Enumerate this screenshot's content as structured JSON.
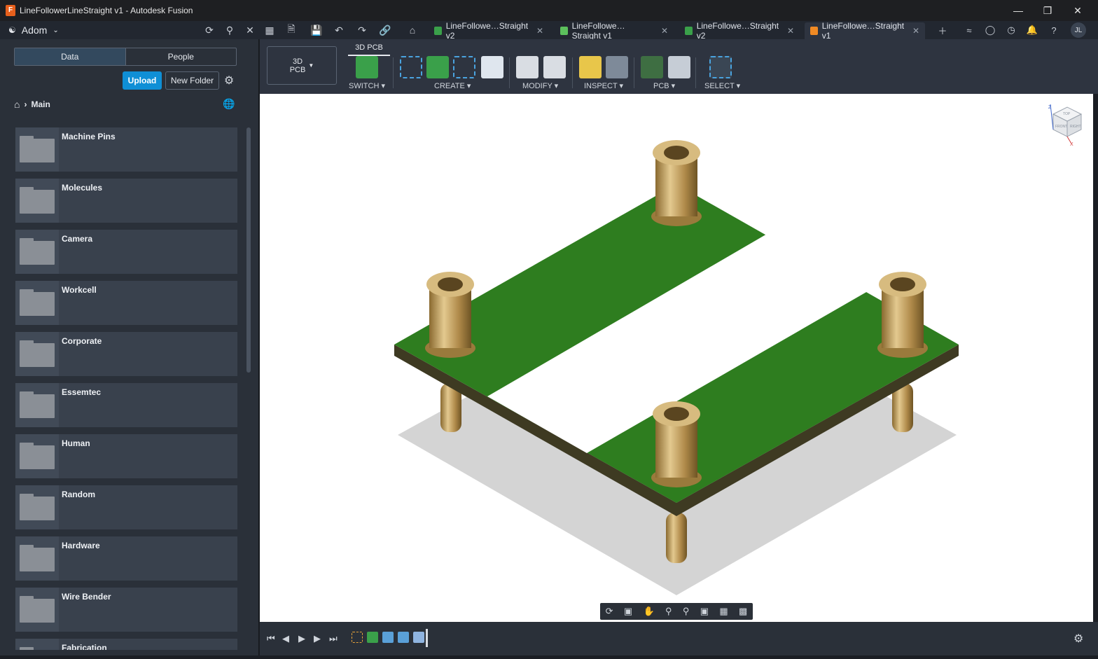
{
  "window": {
    "title": "LineFollowerLineStraight v1 - Autodesk Fusion",
    "app_icon": "F"
  },
  "appbar": {
    "user": "Adom",
    "tabs": [
      {
        "label": "LineFollowe…Straight v2",
        "icon": "pcb-icon",
        "active": false
      },
      {
        "label": "LineFollowe…Straight v1",
        "icon": "schematic-icon",
        "active": false
      },
      {
        "label": "LineFollowe…Straight v2",
        "icon": "pcb-icon",
        "active": false
      },
      {
        "label": "LineFollowe…Straight v1",
        "icon": "3d-pcb-icon",
        "active": true
      }
    ],
    "avatar": "JL"
  },
  "datapanel": {
    "tab_data": "Data",
    "tab_people": "People",
    "upload": "Upload",
    "new_folder": "New Folder",
    "breadcrumb": "Main",
    "folders": [
      "Machine Pins",
      "Molecules",
      "Camera",
      "Workcell",
      "Corporate",
      "Essemtec",
      "Human",
      "Random",
      "Hardware",
      "Wire Bender",
      "Fabrication"
    ]
  },
  "ribbon": {
    "workspace": "3D\nPCB",
    "workspace_line1": "3D",
    "workspace_line2": "PCB",
    "active_tab": "3D PCB",
    "groups": [
      "SWITCH",
      "CREATE",
      "MODIFY",
      "INSPECT",
      "PCB",
      "SELECT"
    ]
  },
  "colors": {
    "accent": "#0f8fd6",
    "board": "#2e7d1f",
    "pin": "#b8955a",
    "panel": "#2a3039"
  },
  "viewcube": {
    "top": "TOP",
    "front": "FRONT",
    "right": "RIGHT",
    "z": "Z",
    "x": "X"
  }
}
